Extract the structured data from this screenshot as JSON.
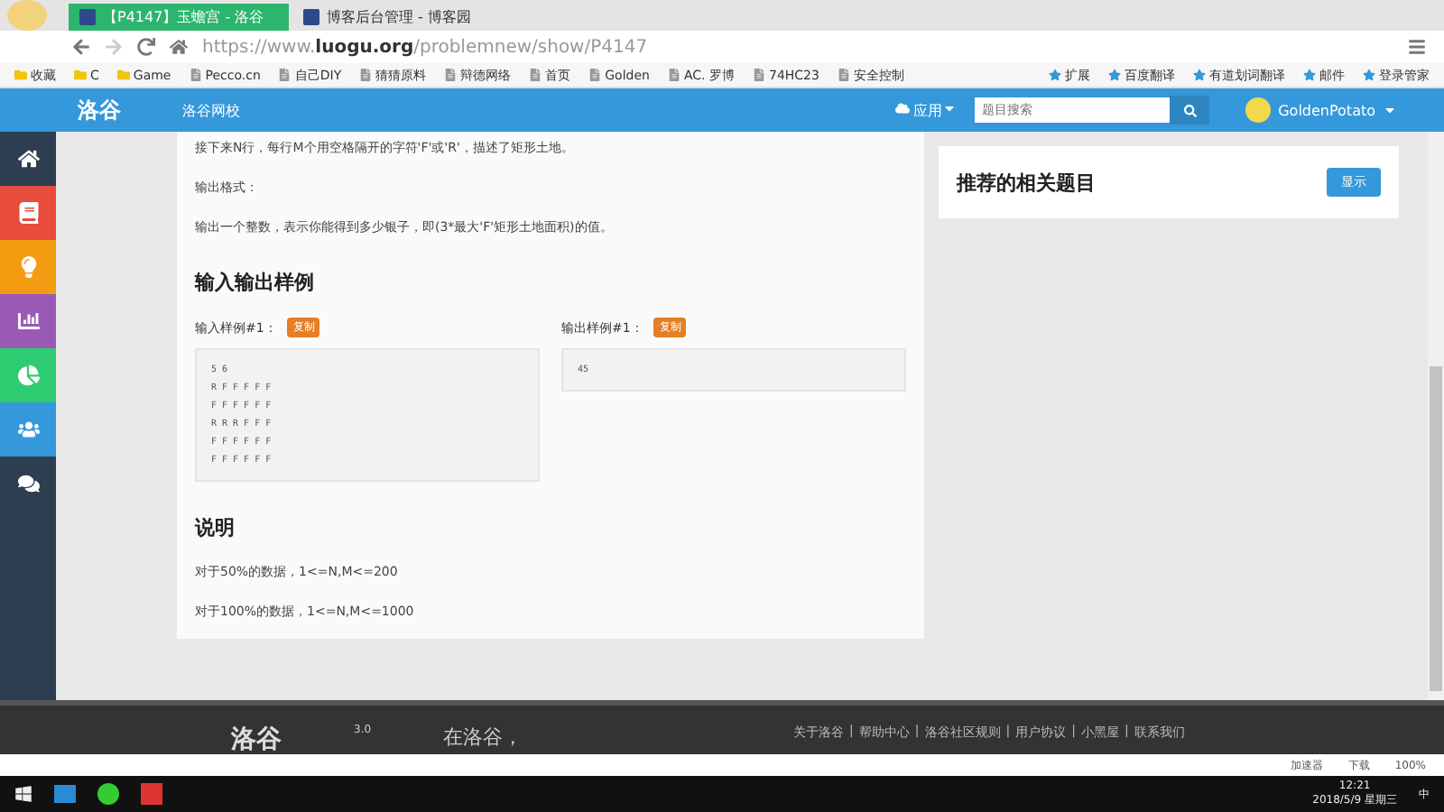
{
  "browser": {
    "tabs": [
      {
        "title": "【P4147】玉蟾宫 - 洛谷",
        "selected": true
      },
      {
        "title": "博客后台管理 - 博客园",
        "selected": false
      }
    ],
    "url": {
      "scheme": "https://www.",
      "host": "luogu.org",
      "path": "/problemnew/show/P4147"
    },
    "bookmarks": [
      "收藏",
      "C",
      "Game",
      "Pecco.cn",
      "自己DIY",
      "猜猜原料",
      "辩德网络",
      "首页",
      "Golden",
      "AC. 罗博",
      "74HC23",
      "安全控制"
    ],
    "extensions": [
      "扩展",
      "百度翻译",
      "有道划词翻译",
      "邮件",
      "登录管家"
    ]
  },
  "site_header": {
    "logo": "洛谷",
    "school": "洛谷网校",
    "apps": "应用",
    "search": {
      "placeholder": "题目搜索"
    },
    "user": "GoldenPotato"
  },
  "sidebar": {
    "items": [
      {
        "color": "#2c3e50"
      },
      {
        "color": "#e74c3c"
      },
      {
        "color": "#f39c12"
      },
      {
        "color": "#9b59b6"
      },
      {
        "color": "#2ecc71"
      },
      {
        "color": "#3498db"
      },
      {
        "color": "#2c3e50"
      }
    ]
  },
  "problem": {
    "input_text": "接下来N行，每行M个用空格隔开的字符'F'或'R'，描述了矩形土地。",
    "output_heading": "输出格式：",
    "output_text": "输出一个整数，表示你能得到多少银子，即(3*最大'F'矩形土地面积)的值。",
    "samples_heading": "输入输出样例",
    "samples": [
      {
        "label": "输入样例#1：",
        "copy": "复制",
        "lines": [
          "5 6",
          "R F F F F F",
          "F F F F F F",
          "R R R F F F",
          "F F F F F F",
          "F F F F F F"
        ]
      },
      {
        "label": "输出样例#1：",
        "copy": "复制",
        "lines": [
          "45"
        ]
      }
    ],
    "notes_heading": "说明",
    "notes": [
      "对于50%的数据，1<=N,M<=200",
      "对于100%的数据，1<=N,M<=1000"
    ]
  },
  "related": {
    "title": "推荐的相关题目",
    "button": "显示"
  },
  "footer": {
    "logo": "洛谷",
    "version": "3.0",
    "separator": "|",
    "slogan": "在洛谷，",
    "links": [
      "关于洛谷",
      "帮助中心",
      "洛谷社区规则",
      "用户协议",
      "小黑屋",
      "联系我们"
    ]
  },
  "status_bar": {
    "items": [
      "加速器",
      "下载"
    ],
    "zoom": "100%"
  },
  "taskbar": {
    "ime": "中",
    "time": "12:21",
    "date": "2018/5/9 星期三"
  }
}
